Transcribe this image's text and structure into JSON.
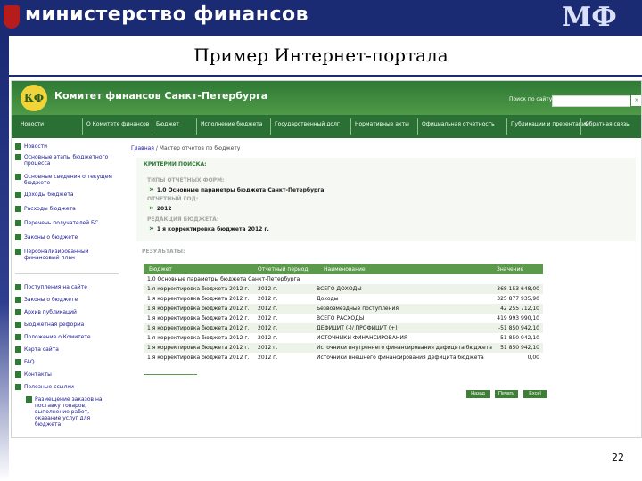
{
  "slide": {
    "ministry": "министерство финансов",
    "logo_text": "МФ",
    "title": "Пример Интернет-портала",
    "page_number": "22"
  },
  "site": {
    "title": "Комитет финансов Санкт-Петербурга",
    "emblem_text": "КФ",
    "search_label": "Поиск по сайту",
    "search_value": "",
    "search_go": "»"
  },
  "nav": [
    "Новости",
    "О Комитете финансов",
    "Бюджет",
    "Исполнение бюджета",
    "Государственный долг",
    "Нормативные акты",
    "Официальная отчетность",
    "Публикации и презентации",
    "Обратная связь"
  ],
  "sidebar": {
    "main": [
      "Новости",
      "Основные этапы бюджетного процесса",
      "Основные сведения о текущем бюджете",
      "Доходы бюджета",
      "Расходы бюджета",
      "Перечень получателей БС",
      "Законы о бюджете",
      "Персонализированный финансовый план"
    ],
    "secondary": [
      "Поступления на сайте",
      "Законы о бюджете",
      "Архив публикаций",
      "Бюджетная реформа",
      "Положение о Комитете",
      "Карта сайта",
      "FAQ",
      "Контакты",
      "Полезные ссылки",
      "Размещение заказов на поставку товаров, выполнение работ, оказание услуг для бюджета"
    ]
  },
  "content": {
    "breadcrumb_link": "Главная",
    "breadcrumb_rest": "/ Мастер отчетов по бюджету",
    "criteria_title": "КРИТЕРИИ ПОИСКА:",
    "form_types_label": "ТИПЫ ОТЧЕТНЫХ ФОРМ:",
    "form_types_value": "1.0 Основные параметры бюджета Санкт-Петербурга",
    "year_label": "ОТЧЕТНЫЙ ГОД:",
    "year_value": "2012",
    "edition_label": "РЕДАКЦИЯ БЮДЖЕТА:",
    "edition_value": "1 я корректировка бюджета 2012 г.",
    "results_label": "РЕЗУЛЬТАТЫ:",
    "buttons": [
      "Назад",
      "Печать",
      "Excel"
    ]
  },
  "table": {
    "headers": [
      "Бюджет",
      "Отчетный период",
      "Наименование",
      "Значение"
    ],
    "group": "1.0 Основные параметры бюджета Санкт-Петербурга",
    "rows": [
      [
        "1 я корректировка бюджета 2012 г.",
        "2012 г.",
        "ВСЕГО ДОХОДЫ",
        "368 153 648,00"
      ],
      [
        "1 я корректировка бюджета 2012 г.",
        "2012 г.",
        "Доходы",
        "325 877 935,90"
      ],
      [
        "1 я корректировка бюджета 2012 г.",
        "2012 г.",
        "Безвозмездные поступления",
        "42 255 712,10"
      ],
      [
        "1 я корректировка бюджета 2012 г.",
        "2012 г.",
        "ВСЕГО РАСХОДЫ",
        "419 993 990,10"
      ],
      [
        "1 я корректировка бюджета 2012 г.",
        "2012 г.",
        "ДЕФИЦИТ (-)/ ПРОФИЦИТ (+)",
        "-51 850 942,10"
      ],
      [
        "1 я корректировка бюджета 2012 г.",
        "2012 г.",
        "ИСТОЧНИКИ ФИНАНСИРОВАНИЯ",
        "51 850 942,10"
      ],
      [
        "1 я корректировка бюджета 2012 г.",
        "2012 г.",
        "Источники внутреннего финансирования дефицита бюджета",
        "51 850 942,10"
      ],
      [
        "1 я корректировка бюджета 2012 г.",
        "2012 г.",
        "Источники внешнего финансирования дефицита бюджета",
        "0,00"
      ]
    ]
  },
  "colors": {
    "ppt_blue": "#1a2a73",
    "site_green": "#2f7a35",
    "table_header": "#5a9a48",
    "row_alt": "#eef3ea"
  }
}
